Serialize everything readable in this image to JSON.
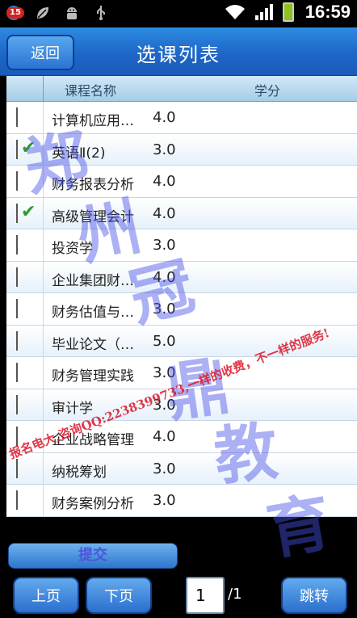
{
  "status_bar": {
    "notification_count": "15",
    "left_icons": [
      "notification-app-icon",
      "leaf-icon",
      "android-icon",
      "usb-icon"
    ],
    "right_icons": [
      "wifi-icon",
      "signal-icon",
      "battery-icon"
    ],
    "time": "16:59"
  },
  "header": {
    "back_label": "返回",
    "title": "选课列表"
  },
  "table": {
    "col_name": "课程名称",
    "col_credit": "学分",
    "rows": [
      {
        "name": "计算机应用…",
        "credit": "4.0",
        "checked": false
      },
      {
        "name": "英语Ⅱ(2)",
        "credit": "3.0",
        "checked": true
      },
      {
        "name": "财务报表分析",
        "credit": "4.0",
        "checked": false
      },
      {
        "name": "高级管理会计",
        "credit": "4.0",
        "checked": true
      },
      {
        "name": "投资学",
        "credit": "3.0",
        "checked": false
      },
      {
        "name": "企业集团财…",
        "credit": "4.0",
        "checked": false
      },
      {
        "name": "财务估值与…",
        "credit": "3.0",
        "checked": false
      },
      {
        "name": "毕业论文（…",
        "credit": "5.0",
        "checked": false
      },
      {
        "name": "财务管理实践",
        "credit": "3.0",
        "checked": false
      },
      {
        "name": "审计学",
        "credit": "3.0",
        "checked": false
      },
      {
        "name": "企业战略管理",
        "credit": "4.0",
        "checked": false
      },
      {
        "name": "纳税筹划",
        "credit": "3.0",
        "checked": false
      },
      {
        "name": "财务案例分析",
        "credit": "3.0",
        "checked": false
      }
    ]
  },
  "footer": {
    "submit_label": "提交",
    "prev_label": "上页",
    "next_label": "下页",
    "page_value": "1",
    "page_total": "/1",
    "jump_label": "跳转"
  },
  "watermark": {
    "chars": [
      "郑",
      "州",
      "冠",
      "鼎",
      "教",
      "育"
    ],
    "line": "报名电大,咨询QQ:2238399733,一样的收费，不一样的服务!"
  },
  "colors": {
    "title_bar": "#1e66c8",
    "check": "#2e9b2e",
    "watermark_blue": "#4650e6",
    "watermark_red": "#dc1428"
  }
}
